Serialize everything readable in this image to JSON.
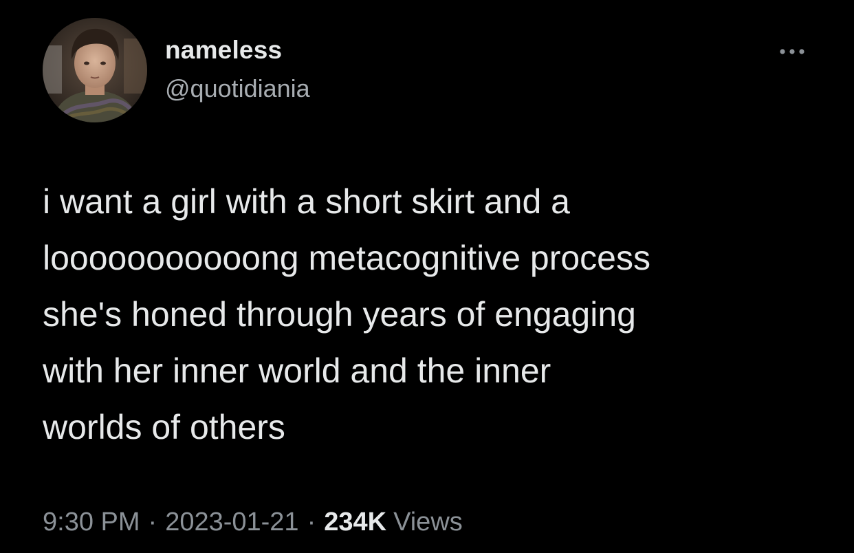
{
  "author": {
    "display_name": "nameless",
    "handle": "@quotidiania"
  },
  "tweet": {
    "lines": [
      "i want a girl with a short skirt and a",
      "looooooooooong metacognitive process",
      "she's honed through years of engaging",
      "with her inner world and the inner",
      "worlds of others"
    ]
  },
  "meta": {
    "time": "9:30 PM",
    "separator": "·",
    "date": "2023-01-21",
    "views_count": "234K",
    "views_label": "Views"
  },
  "icons": {
    "more": "more-horizontal-icon"
  },
  "colors": {
    "background": "#000000",
    "primary_text": "#e7e9ea",
    "secondary_text": "#8b9197"
  }
}
